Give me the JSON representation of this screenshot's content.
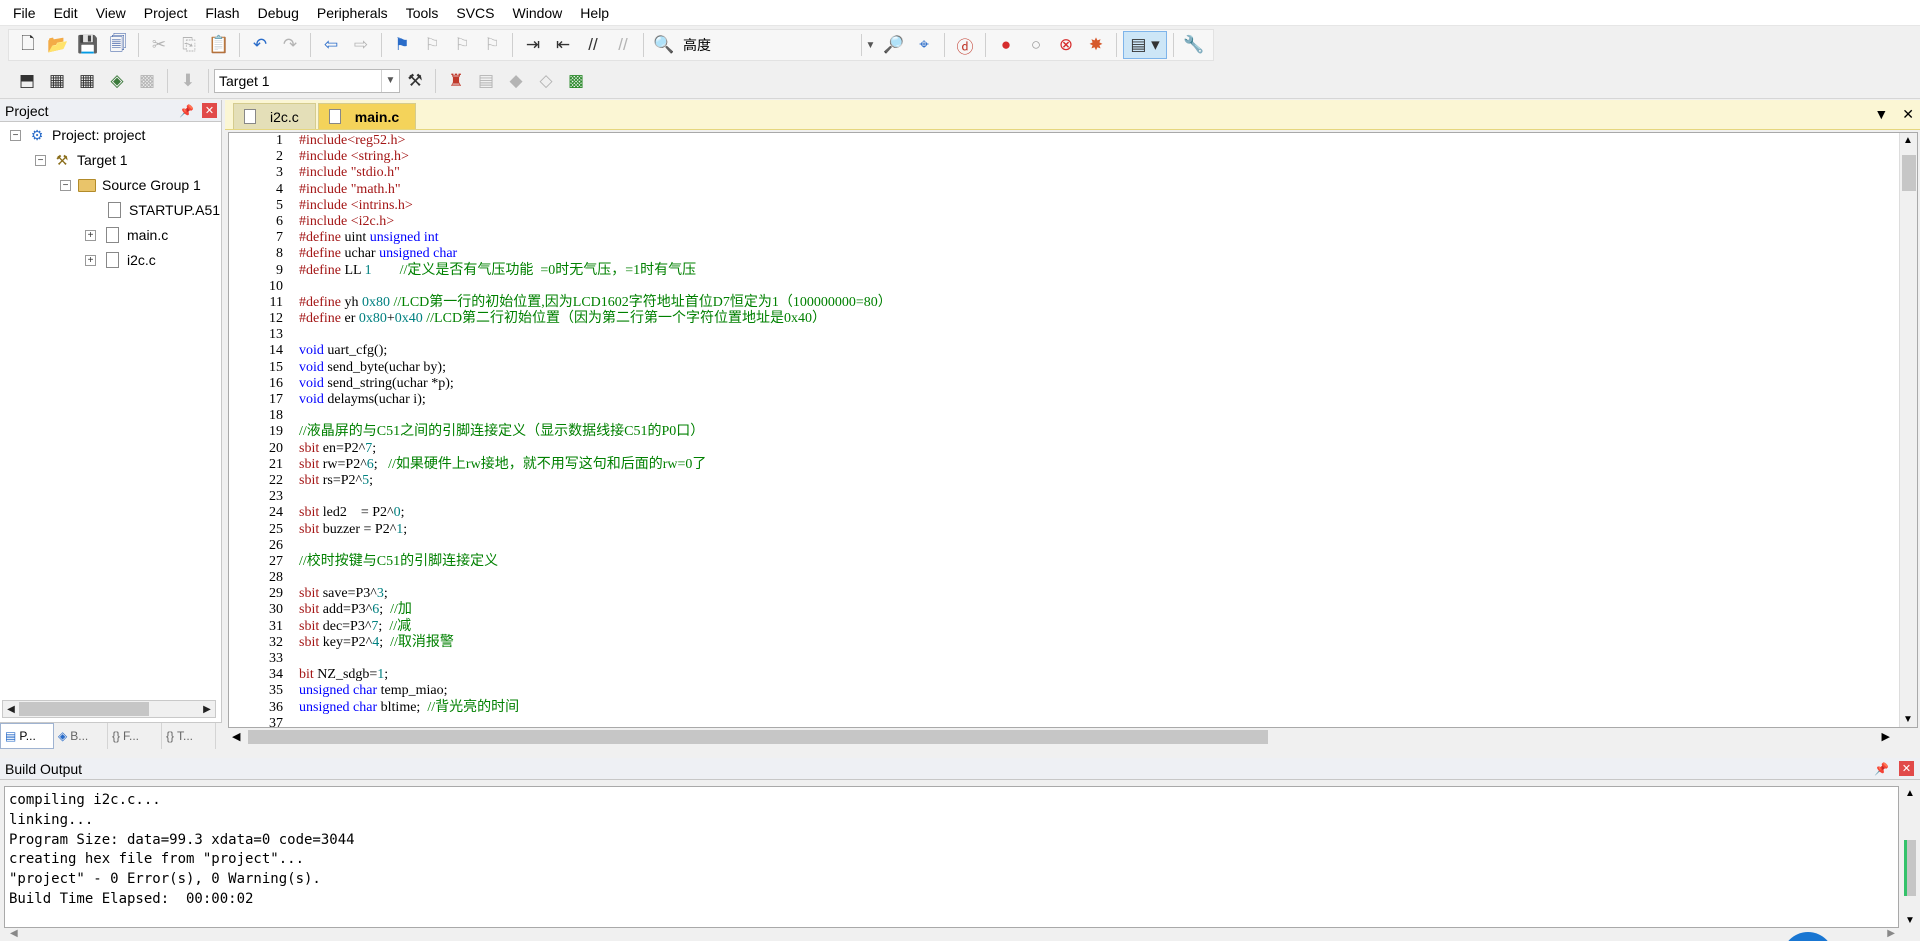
{
  "menu": [
    "File",
    "Edit",
    "View",
    "Project",
    "Flash",
    "Debug",
    "Peripherals",
    "Tools",
    "SVCS",
    "Window",
    "Help"
  ],
  "toolbar": {
    "find_text": "高度",
    "target_select": "Target 1"
  },
  "project_panel": {
    "title": "Project",
    "tree": {
      "project": "Project: project",
      "target": "Target 1",
      "group": "Source Group 1",
      "files": [
        "STARTUP.A51",
        "main.c",
        "i2c.c"
      ]
    },
    "tabs": [
      "P...",
      "B...",
      "F...",
      "T..."
    ]
  },
  "editor": {
    "tabs": [
      {
        "label": "i2c.c",
        "active": false
      },
      {
        "label": "main.c",
        "active": true
      }
    ],
    "lines": [
      {
        "n": "1",
        "segs": [
          [
            "#include<reg52.h>",
            "pre"
          ]
        ]
      },
      {
        "n": "2",
        "segs": [
          [
            "#include ",
            "pre"
          ],
          [
            "<string.h>",
            "inc"
          ]
        ]
      },
      {
        "n": "3",
        "segs": [
          [
            "#include ",
            "pre"
          ],
          [
            "\"stdio.h\"",
            "inc"
          ]
        ]
      },
      {
        "n": "4",
        "segs": [
          [
            "#include ",
            "pre"
          ],
          [
            "\"math.h\"",
            "inc"
          ]
        ]
      },
      {
        "n": "5",
        "segs": [
          [
            "#include ",
            "pre"
          ],
          [
            "<intrins.h>",
            "inc"
          ]
        ]
      },
      {
        "n": "6",
        "segs": [
          [
            "#include ",
            "pre"
          ],
          [
            "<i2c.h>",
            "inc"
          ]
        ]
      },
      {
        "n": "7",
        "segs": [
          [
            "#define ",
            "pre"
          ],
          [
            "uint ",
            "ct"
          ],
          [
            "unsigned int",
            "kw"
          ]
        ]
      },
      {
        "n": "8",
        "segs": [
          [
            "#define ",
            "pre"
          ],
          [
            "uchar ",
            "ct"
          ],
          [
            "unsigned char",
            "kw"
          ]
        ]
      },
      {
        "n": "9",
        "segs": [
          [
            "#define ",
            "pre"
          ],
          [
            "LL ",
            "ct"
          ],
          [
            "1",
            "num"
          ],
          [
            "        //定义是否有气压功能  =0时无气压，=1时有气压",
            "cm"
          ]
        ]
      },
      {
        "n": "10",
        "segs": []
      },
      {
        "n": "11",
        "segs": [
          [
            "#define ",
            "pre"
          ],
          [
            "yh ",
            "ct"
          ],
          [
            "0x80",
            "num"
          ],
          [
            " //LCD第一行的初始位置,因为LCD1602字符地址首位D7恒定为1（100000000=80）",
            "cm"
          ]
        ]
      },
      {
        "n": "12",
        "segs": [
          [
            "#define ",
            "pre"
          ],
          [
            "er ",
            "ct"
          ],
          [
            "0x80",
            "num"
          ],
          [
            "+",
            "ct"
          ],
          [
            "0x40",
            "num"
          ],
          [
            " //LCD第二行初始位置（因为第二行第一个字符位置地址是0x40）",
            "cm"
          ]
        ]
      },
      {
        "n": "13",
        "segs": []
      },
      {
        "n": "14",
        "segs": [
          [
            "void ",
            "kw"
          ],
          [
            "uart_cfg();",
            "ct"
          ]
        ]
      },
      {
        "n": "15",
        "segs": [
          [
            "void ",
            "kw"
          ],
          [
            "send_byte(uchar by);",
            "ct"
          ]
        ]
      },
      {
        "n": "16",
        "segs": [
          [
            "void ",
            "kw"
          ],
          [
            "send_string(uchar *p);",
            "ct"
          ]
        ]
      },
      {
        "n": "17",
        "segs": [
          [
            "void ",
            "kw"
          ],
          [
            "delayms(uchar i);",
            "ct"
          ]
        ]
      },
      {
        "n": "18",
        "segs": []
      },
      {
        "n": "19",
        "segs": [
          [
            "//液晶屏的与C51之间的引脚连接定义（显示数据线接C51的P0口）",
            "cm"
          ]
        ]
      },
      {
        "n": "20",
        "segs": [
          [
            "sbit ",
            "pre"
          ],
          [
            "en=P2^",
            "ct"
          ],
          [
            "7",
            "num"
          ],
          [
            ";",
            "ct"
          ]
        ]
      },
      {
        "n": "21",
        "segs": [
          [
            "sbit ",
            "pre"
          ],
          [
            "rw=P2^",
            "ct"
          ],
          [
            "6",
            "num"
          ],
          [
            ";   ",
            "ct"
          ],
          [
            "//如果硬件上rw接地，就不用写这句和后面的rw=0了",
            "cm"
          ]
        ]
      },
      {
        "n": "22",
        "segs": [
          [
            "sbit ",
            "pre"
          ],
          [
            "rs=P2^",
            "ct"
          ],
          [
            "5",
            "num"
          ],
          [
            ";",
            "ct"
          ]
        ]
      },
      {
        "n": "23",
        "segs": []
      },
      {
        "n": "24",
        "segs": [
          [
            "sbit ",
            "pre"
          ],
          [
            "led2    = P2^",
            "ct"
          ],
          [
            "0",
            "num"
          ],
          [
            ";",
            "ct"
          ]
        ]
      },
      {
        "n": "25",
        "segs": [
          [
            "sbit ",
            "pre"
          ],
          [
            "buzzer = P2^",
            "ct"
          ],
          [
            "1",
            "num"
          ],
          [
            ";",
            "ct"
          ]
        ]
      },
      {
        "n": "26",
        "segs": []
      },
      {
        "n": "27",
        "segs": [
          [
            "//校时按键与C51的引脚连接定义",
            "cm"
          ]
        ]
      },
      {
        "n": "28",
        "segs": []
      },
      {
        "n": "29",
        "segs": [
          [
            "sbit ",
            "pre"
          ],
          [
            "save=P3^",
            "ct"
          ],
          [
            "3",
            "num"
          ],
          [
            ";",
            "ct"
          ]
        ]
      },
      {
        "n": "30",
        "segs": [
          [
            "sbit ",
            "pre"
          ],
          [
            "add=P3^",
            "ct"
          ],
          [
            "6",
            "num"
          ],
          [
            ";  ",
            "ct"
          ],
          [
            "//加",
            "cm"
          ]
        ]
      },
      {
        "n": "31",
        "segs": [
          [
            "sbit ",
            "pre"
          ],
          [
            "dec=P3^",
            "ct"
          ],
          [
            "7",
            "num"
          ],
          [
            ";  ",
            "ct"
          ],
          [
            "//减",
            "cm"
          ]
        ]
      },
      {
        "n": "32",
        "segs": [
          [
            "sbit ",
            "pre"
          ],
          [
            "key=P2^",
            "ct"
          ],
          [
            "4",
            "num"
          ],
          [
            ";  ",
            "ct"
          ],
          [
            "//取消报警",
            "cm"
          ]
        ]
      },
      {
        "n": "33",
        "segs": []
      },
      {
        "n": "34",
        "segs": [
          [
            "bit ",
            "pre"
          ],
          [
            "NZ_sdgb=",
            "ct"
          ],
          [
            "1",
            "num"
          ],
          [
            ";",
            "ct"
          ]
        ]
      },
      {
        "n": "35",
        "segs": [
          [
            "unsigned char ",
            "kw"
          ],
          [
            "temp_miao;",
            "ct"
          ]
        ]
      },
      {
        "n": "36",
        "segs": [
          [
            "unsigned char ",
            "kw"
          ],
          [
            "bltime;  ",
            "ct"
          ],
          [
            "//背光亮的时间",
            "cm"
          ]
        ]
      },
      {
        "n": "37",
        "segs": []
      }
    ]
  },
  "build_output": {
    "title": "Build Output",
    "lines": [
      "compiling i2c.c...",
      "linking...",
      "Program Size: data=99.3 xdata=0 code=3044",
      "creating hex file from \"project\"...",
      "\"project\" - 0 Error(s), 0 Warning(s).",
      "Build Time Elapsed:  00:00:02"
    ]
  },
  "colors": {
    "keyword": "#0000ff",
    "preprocessor": "#a31515",
    "comment": "#008000",
    "number": "#008080",
    "active_tab": "#f4d35a"
  }
}
